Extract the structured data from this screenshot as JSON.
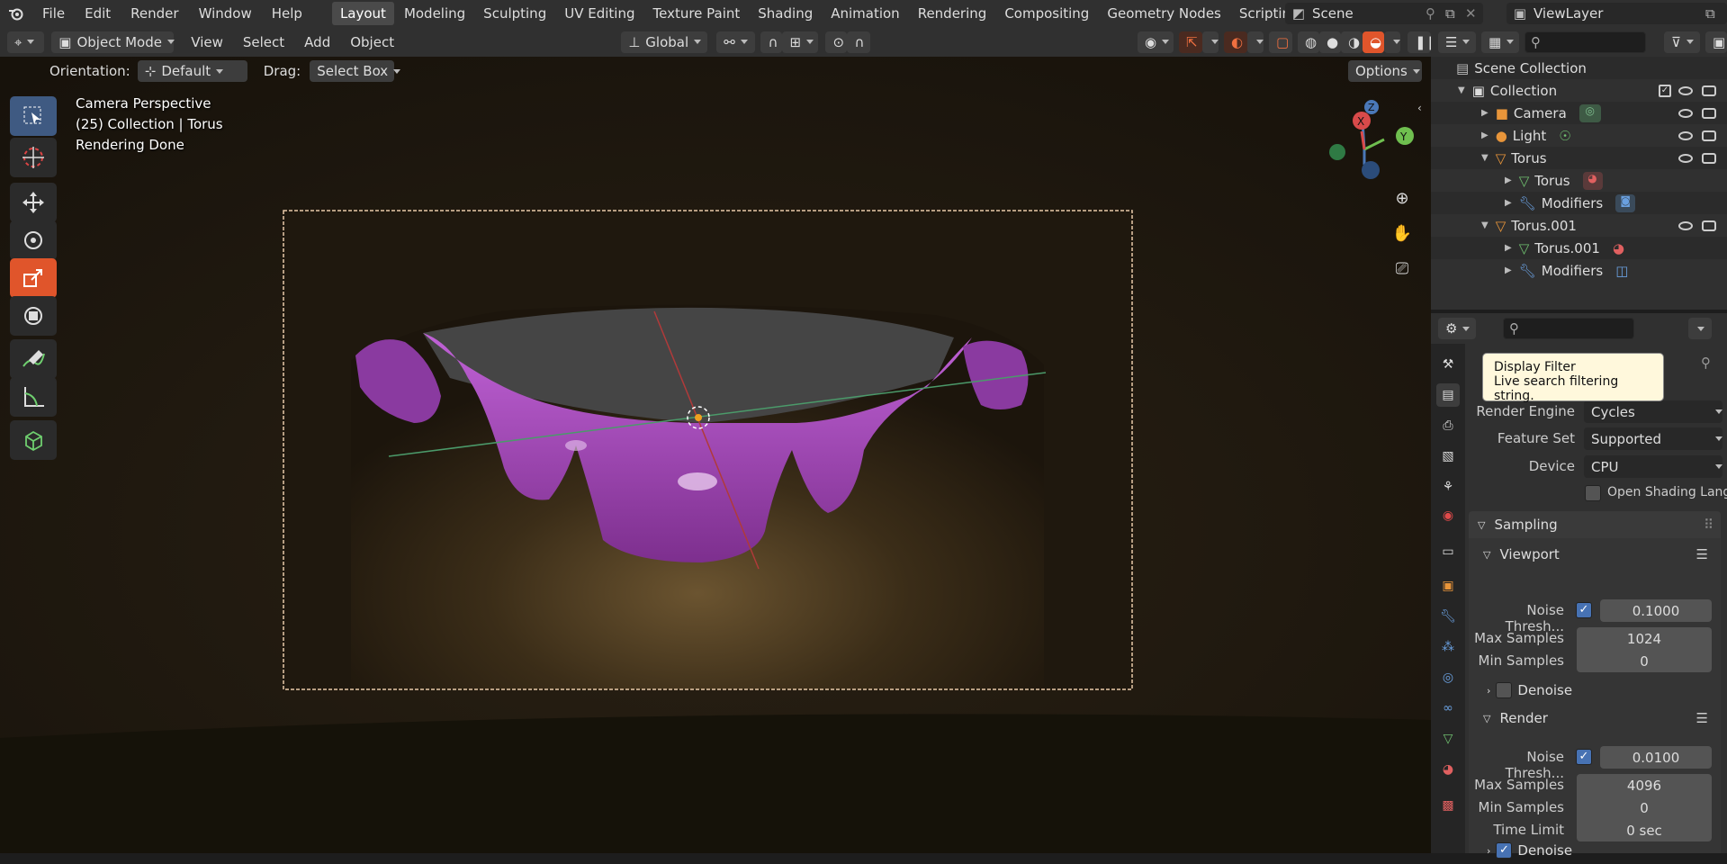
{
  "topbar": {
    "menus": [
      "File",
      "Edit",
      "Render",
      "Window",
      "Help"
    ],
    "workspaces": [
      "Layout",
      "Modeling",
      "Sculpting",
      "UV Editing",
      "Texture Paint",
      "Shading",
      "Animation",
      "Rendering",
      "Compositing",
      "Geometry Nodes",
      "Scripting"
    ],
    "active_workspace": "Layout",
    "scene_name": "Scene",
    "view_layer": "ViewLayer"
  },
  "header": {
    "mode": "Object Mode",
    "menus": [
      "View",
      "Select",
      "Add",
      "Object"
    ],
    "transform": "Global"
  },
  "tool_settings": {
    "orientation_label": "Orientation:",
    "orientation_value": "Default",
    "drag_label": "Drag:",
    "drag_value": "Select Box",
    "options": "Options"
  },
  "viewport_info": {
    "line1": "Camera Perspective",
    "line2": "(25) Collection | Torus",
    "line3": "Rendering Done"
  },
  "gizmo": {
    "x": "X",
    "y": "Y",
    "z": "Z"
  },
  "outliner": {
    "scene_collection": "Scene Collection",
    "rows": [
      "Collection",
      "Camera",
      "Light",
      "Torus",
      "Torus",
      "Modifiers",
      "Torus.001",
      "Torus.001",
      "Modifiers"
    ]
  },
  "tooltip": {
    "title": "Display Filter",
    "desc": "Live search filtering string."
  },
  "properties": {
    "render_engine_label": "Render Engine",
    "render_engine": "Cycles",
    "feature_set_label": "Feature Set",
    "feature_set": "Supported",
    "device_label": "Device",
    "device": "CPU",
    "osl_label": "Open Shading Lang...",
    "sampling": "Sampling",
    "viewport": {
      "title": "Viewport",
      "noise_label": "Noise Thresh...",
      "noise": "0.1000",
      "max_label": "Max Samples",
      "max": "1024",
      "min_label": "Min Samples",
      "min": "0",
      "denoise": "Denoise"
    },
    "render": {
      "title": "Render",
      "noise_label": "Noise Thresh...",
      "noise": "0.0100",
      "max_label": "Max Samples",
      "max": "4096",
      "min_label": "Min Samples",
      "min": "0",
      "time_label": "Time Limit",
      "time": "0 sec",
      "denoise": "Denoise"
    }
  },
  "colors": {
    "accent": "#4772b3",
    "active_tool": "#e0552b",
    "object_purple": "#b04cc4"
  }
}
